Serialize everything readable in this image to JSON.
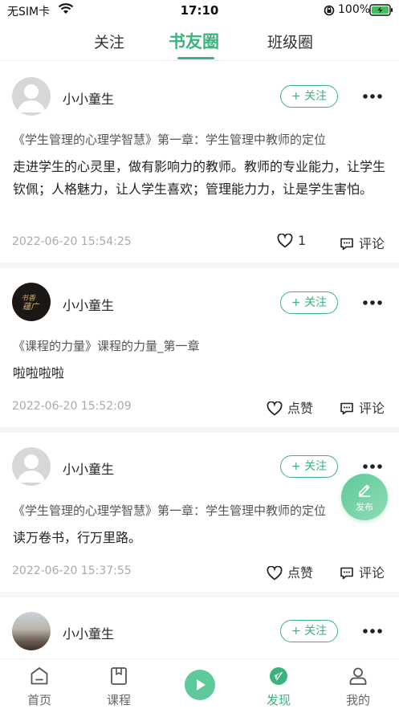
{
  "status": {
    "carrier": "无SIM卡",
    "time": "17:10",
    "battery": "100%"
  },
  "tabs": [
    "关注",
    "书友圈",
    "班级圈"
  ],
  "posts": [
    {
      "username": "小小童生",
      "follow": "+ 关注",
      "book": "《学生管理的心理学智慧》第一章：学生管理中教师的定位",
      "content": " 走进学生的心灵里，做有影响力的教师。教师的专业能力，让学生钦佩；人格魅力，让人学生喜欢；管理能力力，让是学生害怕。",
      "date": "2022-06-20 15:54:25",
      "like": "1",
      "comment": "评论"
    },
    {
      "username": "小小童生",
      "follow": "+ 关注",
      "book": "《课程的力量》课程的力量_第一章",
      "content": " 啦啦啦啦",
      "date": "2022-06-20 15:52:09",
      "like": "点赞",
      "comment": "评论"
    },
    {
      "username": "小小童生",
      "follow": "+ 关注",
      "book": "《学生管理的心理学智慧》第一章：学生管理中教师的定位",
      "content": " 读万卷书，行万里路。",
      "date": "2022-06-20 15:37:55",
      "like": "点赞",
      "comment": "评论"
    },
    {
      "username": "小小童生",
      "follow": "+ 关注"
    }
  ],
  "avatar_texts": [
    "书香",
    "蕴广"
  ],
  "fab_label": "发布",
  "nav": [
    "首页",
    "课程",
    "发现",
    "我的"
  ],
  "colors": {
    "accent": "#3cb27e",
    "date": "#aaaaaa",
    "divider": "#f6f6f6"
  },
  "icons": {
    "more": "ellipsis-icon",
    "like": "heart-icon",
    "comment": "comment-icon",
    "fab": "edit-pencil-icon",
    "nav": [
      "home-icon",
      "book-icon",
      "play-icon",
      "compass-icon",
      "user-icon"
    ]
  }
}
